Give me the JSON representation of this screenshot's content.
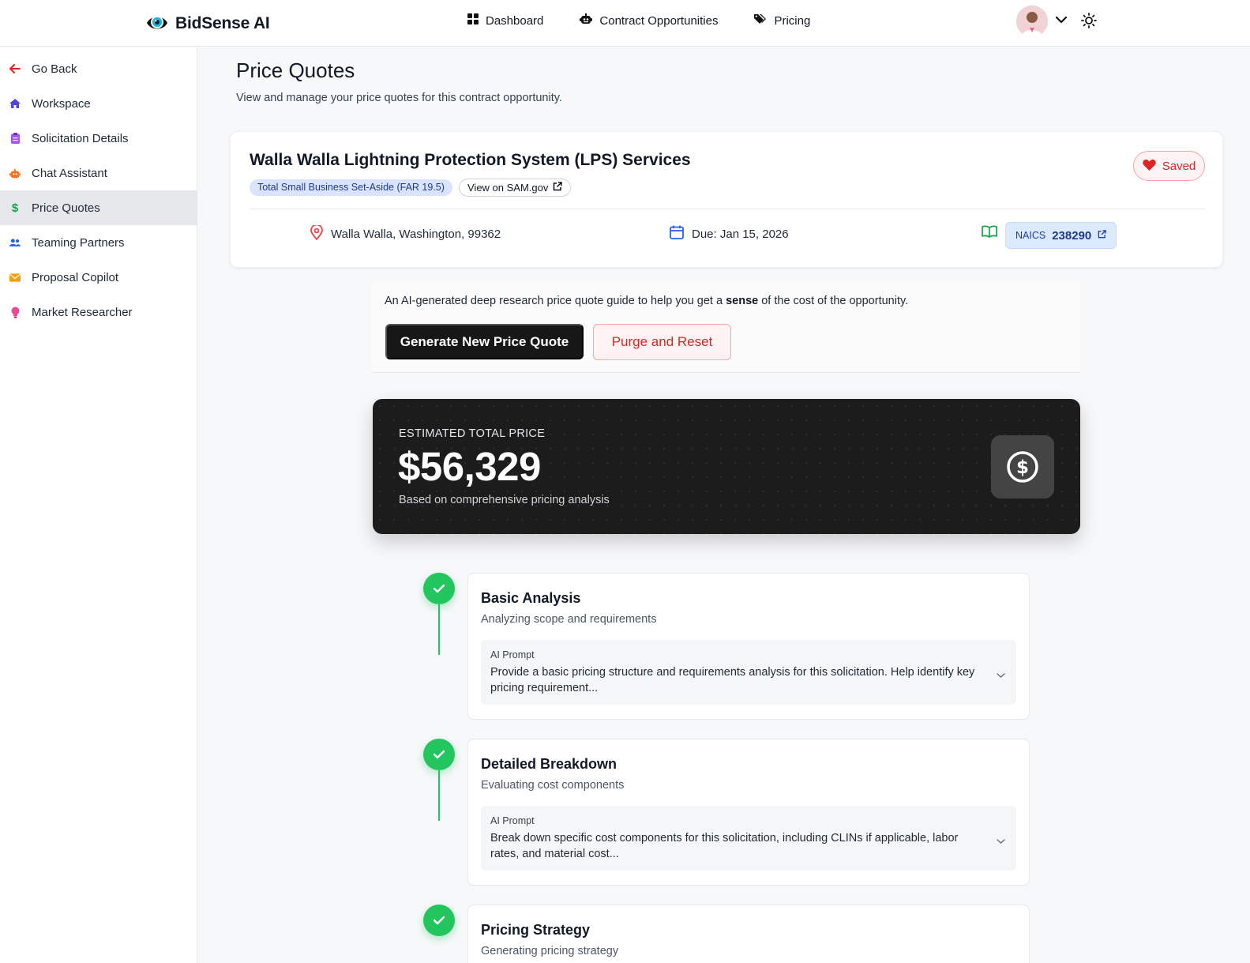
{
  "brand": {
    "name": "BidSense AI"
  },
  "topnav": [
    {
      "label": "Dashboard",
      "icon": "grid-icon"
    },
    {
      "label": "Contract Opportunities",
      "icon": "robot-icon"
    },
    {
      "label": "Pricing",
      "icon": "tags-icon"
    }
  ],
  "sidebar": {
    "items": [
      {
        "label": "Go Back",
        "icon": "arrow-left-icon",
        "color": "#dc2626"
      },
      {
        "label": "Workspace",
        "icon": "home-icon",
        "color": "#4f46e5"
      },
      {
        "label": "Solicitation Details",
        "icon": "clipboard-icon",
        "color": "#a855f7"
      },
      {
        "label": "Chat Assistant",
        "icon": "robot-icon",
        "color": "#f97316"
      },
      {
        "label": "Price Quotes",
        "icon": "dollar-icon",
        "color": "#16a34a",
        "active": true
      },
      {
        "label": "Teaming Partners",
        "icon": "users-icon",
        "color": "#2563eb"
      },
      {
        "label": "Proposal Copilot",
        "icon": "envelope-icon",
        "color": "#f59e0b"
      },
      {
        "label": "Market Researcher",
        "icon": "lightbulb-icon",
        "color": "#ec4899"
      }
    ]
  },
  "page": {
    "title": "Price Quotes",
    "subtitle": "View and manage your price quotes for this contract opportunity."
  },
  "opportunity": {
    "title": "Walla Walla Lightning Protection System (LPS) Services",
    "set_aside": "Total Small Business Set-Aside (FAR 19.5)",
    "sam_link": "View on SAM.gov",
    "saved_label": "Saved",
    "location": "Walla Walla, Washington, 99362",
    "due": "Due: Jan 15, 2026",
    "naics_label": "NAICS",
    "naics_code": "238290"
  },
  "guide": {
    "text_before": "An AI-generated deep research price quote guide to help you get a ",
    "text_bold": "sense",
    "text_after": " of the cost of the opportunity.",
    "generate_label": "Generate New Price Quote",
    "purge_label": "Purge and Reset"
  },
  "estimate": {
    "label": "ESTIMATED TOTAL PRICE",
    "value": "$56,329",
    "subtitle": "Based on comprehensive pricing analysis"
  },
  "steps": [
    {
      "title": "Basic Analysis",
      "subtitle": "Analyzing scope and requirements",
      "prompt_label": "AI Prompt",
      "prompt": "Provide a basic pricing structure and requirements analysis for this solicitation. Help identify key pricing requirement...",
      "status": "complete"
    },
    {
      "title": "Detailed Breakdown",
      "subtitle": "Evaluating cost components",
      "prompt_label": "AI Prompt",
      "prompt": "Break down specific cost components for this solicitation, including CLINs if applicable, labor rates, and material cost...",
      "status": "complete"
    },
    {
      "title": "Pricing Strategy",
      "subtitle": "Generating pricing strategy",
      "status": "complete"
    }
  ],
  "colors": {
    "success": "#22c55e",
    "danger": "#dc2626",
    "price_card_bg": "#1c1c1c"
  }
}
